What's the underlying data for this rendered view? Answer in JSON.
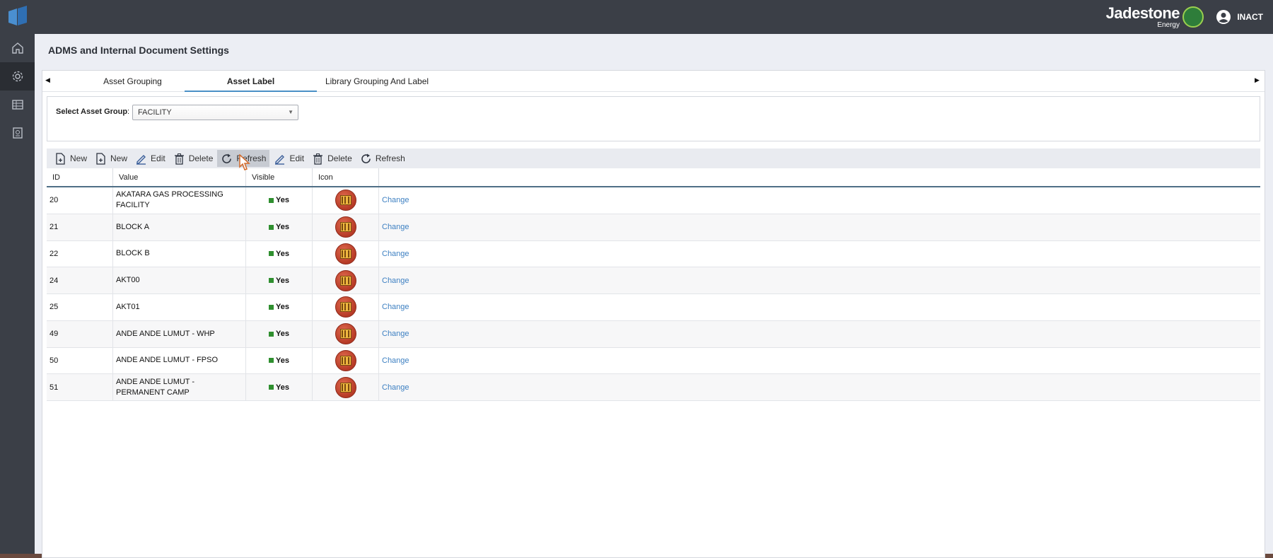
{
  "header": {
    "brand_main": "Jadestone",
    "brand_sub": "Energy",
    "user": "INACT"
  },
  "sidenav": {
    "items": [
      "home-icon",
      "gear-icon",
      "grid-icon",
      "report-icon"
    ],
    "active_index": 1
  },
  "page": {
    "title": "ADMS and Internal Document Settings"
  },
  "tabs": [
    {
      "label": "Asset Grouping",
      "active": false
    },
    {
      "label": "Asset Label",
      "active": true
    },
    {
      "label": "Library Grouping And Label",
      "active": false
    }
  ],
  "filter": {
    "label": "Select Asset Group",
    "colon": ":",
    "value": "FACILITY"
  },
  "toolbar": [
    {
      "label": "New",
      "icon": "new-doc-icon"
    },
    {
      "label": "New",
      "icon": "new-doc-icon"
    },
    {
      "label": "Edit",
      "icon": "edit-icon"
    },
    {
      "label": "Delete",
      "icon": "trash-icon"
    },
    {
      "label": "Refresh",
      "icon": "refresh-icon",
      "hover": true
    },
    {
      "label": "Edit",
      "icon": "edit-icon"
    },
    {
      "label": "Delete",
      "icon": "trash-icon"
    },
    {
      "label": "Refresh",
      "icon": "refresh-icon"
    }
  ],
  "grid": {
    "columns": [
      "ID",
      "Value",
      "Visible",
      "Icon"
    ],
    "rows": [
      {
        "id": "20",
        "value": "AKATARA GAS PROCESSING FACILITY",
        "visible": "Yes",
        "action": "Change"
      },
      {
        "id": "21",
        "value": "BLOCK A",
        "visible": "Yes",
        "action": "Change"
      },
      {
        "id": "22",
        "value": "BLOCK B",
        "visible": "Yes",
        "action": "Change"
      },
      {
        "id": "24",
        "value": "AKT00",
        "visible": "Yes",
        "action": "Change"
      },
      {
        "id": "25",
        "value": "AKT01",
        "visible": "Yes",
        "action": "Change"
      },
      {
        "id": "49",
        "value": "ANDE ANDE LUMUT - WHP",
        "visible": "Yes",
        "action": "Change"
      },
      {
        "id": "50",
        "value": "ANDE ANDE LUMUT - FPSO",
        "visible": "Yes",
        "action": "Change"
      },
      {
        "id": "51",
        "value": "ANDE ANDE LUMUT - PERMANENT CAMP",
        "visible": "Yes",
        "action": "Change"
      }
    ]
  },
  "colors": {
    "topbar": "#3b3f47",
    "accent": "#4a90c6",
    "link": "#3e80c2",
    "visible_green": "#2f8f2f"
  }
}
